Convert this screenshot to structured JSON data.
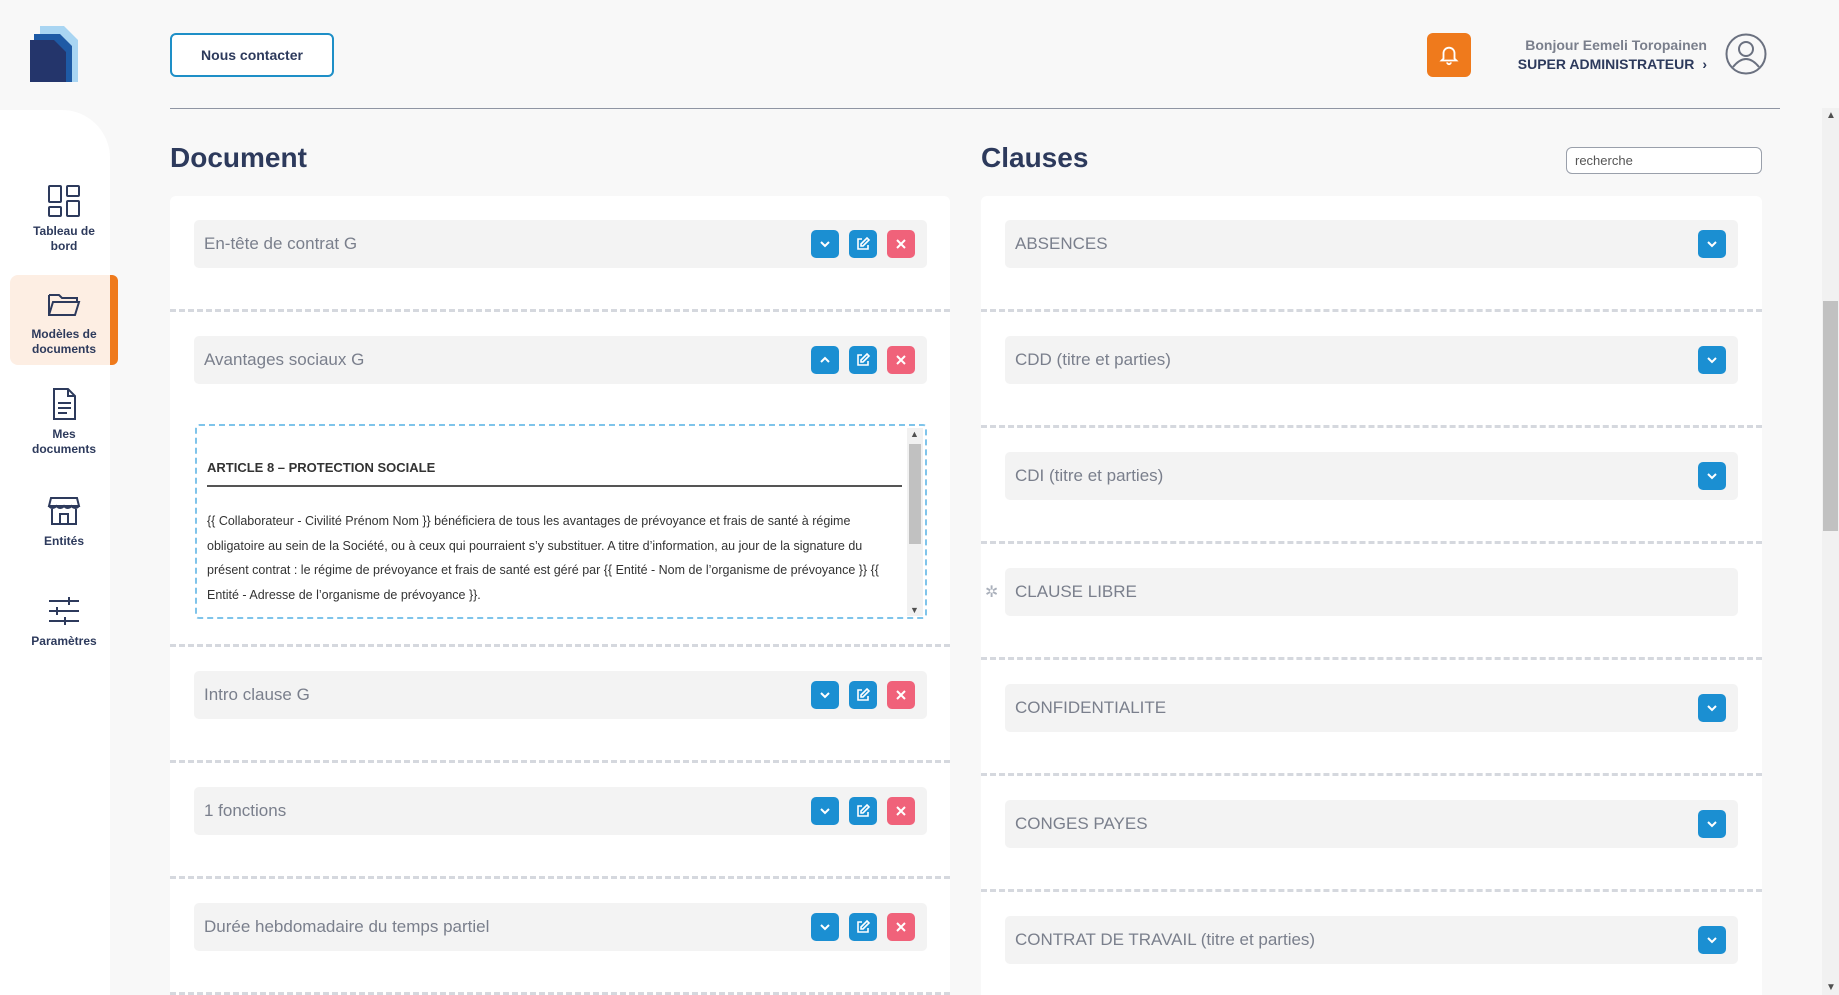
{
  "header": {
    "contact_label": "Nous contacter",
    "greeting": "Bonjour Eemeli Toropainen",
    "role": "SUPER ADMINISTRATEUR",
    "role_chevron": "›"
  },
  "sidebar": {
    "items": [
      {
        "label": "Tableau de bord",
        "icon": "dashboard-icon",
        "active": false
      },
      {
        "label": "Modèles de documents",
        "icon": "folder-icon",
        "active": true
      },
      {
        "label": "Mes documents",
        "icon": "document-icon",
        "active": false
      },
      {
        "label": "Entités",
        "icon": "store-icon",
        "active": false
      },
      {
        "label": "Paramètres",
        "icon": "sliders-icon",
        "active": false
      }
    ]
  },
  "document": {
    "title": "Document",
    "rows": [
      {
        "label": "En-tête de contrat G",
        "expanded": false
      },
      {
        "label": "Avantages sociaux G",
        "expanded": true
      },
      {
        "label": "Intro clause G",
        "expanded": false
      },
      {
        "label": "1 fonctions",
        "expanded": false
      },
      {
        "label": "Durée hebdomadaire du temps partiel",
        "expanded": false
      }
    ],
    "article": {
      "title": "ARTICLE 8 – PROTECTION SOCIALE",
      "body": "{{ Collaborateur - Civilité Prénom Nom }} bénéficiera de tous les avantages de prévoyance et frais de santé à régime obligatoire au sein de la Société, ou à ceux qui pourraient s’y substituer. A titre d’information, au jour de la signature du présent contrat : le régime de prévoyance et frais de santé est géré par {{ Entité - Nom de l’organisme de prévoyance }} {{ Entité - Adresse de l’organisme de prévoyance }}."
    }
  },
  "clauses": {
    "title": "Clauses",
    "search_placeholder": "recherche",
    "rows": [
      {
        "label": "ABSENCES",
        "has_toggle": true
      },
      {
        "label": "CDD (titre et parties)",
        "has_toggle": true
      },
      {
        "label": "CDI (titre et parties)",
        "has_toggle": true
      },
      {
        "label": "CLAUSE LIBRE",
        "has_toggle": false,
        "marker": "✲"
      },
      {
        "label": "CONFIDENTIALITE",
        "has_toggle": true
      },
      {
        "label": "CONGES PAYES",
        "has_toggle": true
      },
      {
        "label": "CONTRAT DE TRAVAIL (titre et parties)",
        "has_toggle": true
      }
    ]
  },
  "colors": {
    "accent_orange": "#ef7a1c",
    "accent_blue": "#1b8fd2",
    "danger": "#f0627a",
    "navy": "#2d3a5c"
  }
}
